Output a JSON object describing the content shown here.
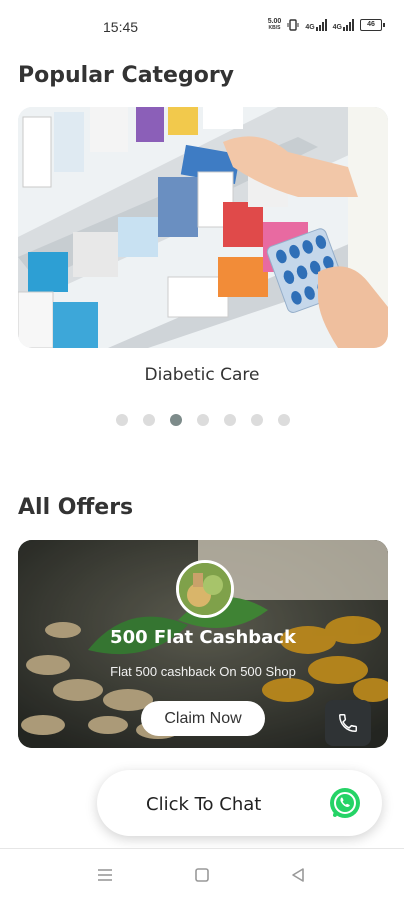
{
  "status_bar": {
    "time": "15:45",
    "net_speed_value": "5.00",
    "net_speed_unit": "KB/S",
    "sim1": "4G",
    "sim2": "4G",
    "battery": "46"
  },
  "popular": {
    "heading": "Popular Category",
    "current_category": "Diabetic Care",
    "dots_count": 7,
    "active_dot": 3
  },
  "offers": {
    "heading": "All Offers",
    "card": {
      "title": "500 Flat Cashback",
      "subtitle": "Flat 500 cashback On 500 Shop",
      "button": "Claim Now"
    }
  },
  "chat": {
    "label": "Click To Chat"
  },
  "colors": {
    "whatsapp": "#25D366",
    "dot_active": "#7d8b8a",
    "dot_inactive": "#dcdcdc"
  },
  "icons": {
    "call": "phone-icon",
    "chat": "whatsapp-icon",
    "nav": [
      "menu-icon",
      "home-square-icon",
      "back-triangle-icon"
    ]
  }
}
